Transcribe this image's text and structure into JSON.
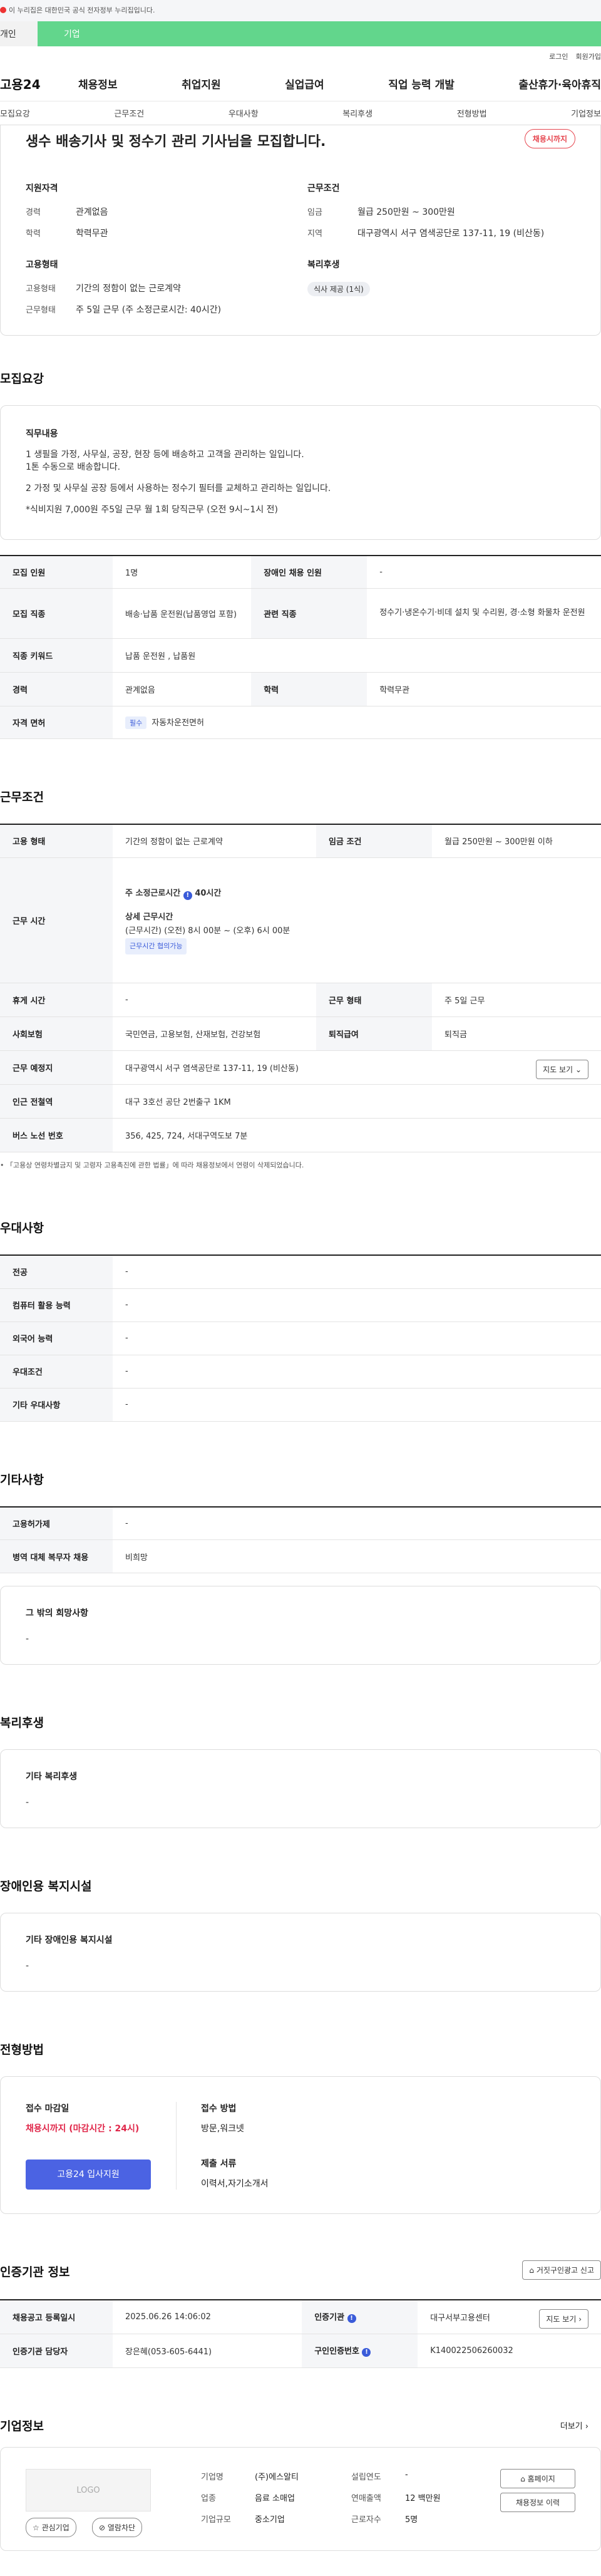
{
  "gov_banner": "이 누리집은 대한민국 공식 전자정부 누리집입니다.",
  "tabs": {
    "personal": "개인",
    "company": "기업"
  },
  "util_links": [
    "로그인",
    "회원가입"
  ],
  "logo": "고용24",
  "gnb": [
    "채용정보",
    "취업지원",
    "실업급여",
    "직업 능력 개발",
    "출산휴가·육아휴직"
  ],
  "anchor_tabs": [
    "모집요강",
    "근무조건",
    "우대사항",
    "복리후생",
    "전형방법",
    "기업정보"
  ],
  "header": {
    "title": "생수 배송기사 및 정수기 관리 기사님을 모집합니다.",
    "status": "채용시까지",
    "support": {
      "heading": "지원자격",
      "rows": [
        {
          "k": "경력",
          "v": "관계없음"
        },
        {
          "k": "학력",
          "v": "학력무관"
        }
      ]
    },
    "employment": {
      "heading": "고용형태",
      "rows": [
        {
          "k": "고용형태",
          "v": "기간의 정함이 없는 근로계약"
        },
        {
          "k": "근무형태",
          "v": "주 5일 근무 (주 소정근로시간: 40시간)"
        }
      ]
    },
    "conditions": {
      "heading": "근무조건",
      "rows": [
        {
          "k": "임금",
          "v": "월급 250만원 ~ 300만원"
        },
        {
          "k": "지역",
          "v": "대구광역시 서구 염색공단로 137-11, 19 (비산동)"
        }
      ]
    },
    "welfare": {
      "heading": "복리후생",
      "chip": "식사 제공 (1식)"
    }
  },
  "recruit": {
    "title": "모집요강",
    "duty_heading": "직무내용",
    "duty_lines": [
      "1 생필을 가정, 사무실, 공장, 현장 등에 배송하고 고객을 관리하는 일입니다.",
      "1톤 수동으로 배송합니다.",
      "",
      "2 가정 및 사무실 공장 등에서 사용하는 정수기 필터를 교체하고 관리하는 일입니다.",
      "",
      "*식비지원 7,000원    주5일 근무    월 1회 당직근무  (오전 9시~1시 전)"
    ],
    "rows": {
      "headcount_k": "모집 인원",
      "headcount_v": "1명",
      "disabled_k": "장애인 채용 인원",
      "disabled_v": "-",
      "job_k": "모집 직종",
      "job_v": "배송·납품 운전원(납품영업 포함)",
      "related_k": "관련 직종",
      "related_v": "정수기·냉온수기·비데 설치 및 수리원, 경·소형 화물차 운전원",
      "keyword_k": "직종 키워드",
      "keyword_v": "납품 운전원 , 납품원",
      "career_k": "경력",
      "career_v": "관계없음",
      "edu_k": "학력",
      "edu_v": "학력무관",
      "license_k": "자격 면허",
      "license_tag": "필수",
      "license_v": "자동차운전면허"
    }
  },
  "work": {
    "title": "근무조건",
    "type_k": "고용 형태",
    "type_v": "기간의 정함이 없는 근로계약",
    "wage_k": "임금 조건",
    "wage_v": "월급 250만원 ~ 300만원 이하",
    "hours_k": "근무 시간",
    "hours_main": "주 소정근로시간",
    "hours_main_value": "40시간",
    "hours_detail_heading": "상세 근무시간",
    "hours_detail": "(근무시간) (오전) 8시 00분 ~ (오후) 6시 00분",
    "hours_tag": "근무시간 협의가능",
    "rest_k": "휴게 시간",
    "rest_v": "-",
    "form_k": "근무 형태",
    "form_v": "주 5일 근무",
    "ins_k": "사회보험",
    "ins_v": "국민연금, 고용보험, 산재보험, 건강보험",
    "pension_k": "퇴직급여",
    "pension_v": "퇴직금",
    "place_k": "근무 예정지",
    "place_v": "대구광역시 서구 염색공단로 137-11, 19 (비산동)",
    "map_btn": "지도 보기",
    "station_k": "인근 전철역",
    "station_v": "대구 3호선 공단 2번출구 1KM",
    "bus_k": "버스 노선 번호",
    "bus_v": "356, 425, 724, 서대구역도보 7분",
    "footnote": "「고용상 연령차별금지 및 고령자 고용촉진에 관한 법률」에 따라 채용정보에서 연령이 삭제되었습니다."
  },
  "pref": {
    "title": "우대사항",
    "rows": [
      {
        "k": "전공",
        "v": "-"
      },
      {
        "k": "컴퓨터 활용 능력",
        "v": "-"
      },
      {
        "k": "외국어 능력",
        "v": "-"
      },
      {
        "k": "우대조건",
        "v": "-"
      },
      {
        "k": "기타 우대사항",
        "v": "-"
      }
    ]
  },
  "etc": {
    "title": "기타사항",
    "rows": [
      {
        "k": "고용허가제",
        "v": "-"
      },
      {
        "k": "병역 대체 복무자 채용",
        "v": "비희망"
      }
    ],
    "other_heading": "그 밖의 희망사항",
    "other_value": "-"
  },
  "welfare": {
    "title": "복리후생",
    "heading": "기타 복리후생",
    "value": "-"
  },
  "disabled": {
    "title": "장애인용 복지시설",
    "heading": "기타 장애인용 복지시설",
    "value": "-"
  },
  "selection": {
    "title": "전형방법",
    "deadline_heading": "접수 마감일",
    "deadline_value": "채용시까지 (마감시간 : 24시)",
    "apply_btn": "고용24 입사지원",
    "method_heading": "접수 방법",
    "method_value": "방문,워크넷",
    "docs_heading": "제출 서류",
    "docs_value": "이력서,자기소개서"
  },
  "agency": {
    "title": "인증기관 정보",
    "report_btn": "거짓구인광고 신고",
    "reg_k": "채용공고 등록일시",
    "reg_v": "2025.06.26 14:06:02",
    "org_k": "인증기관",
    "org_v": "대구서부고용센터",
    "map_btn": "지도 보기",
    "mgr_k": "인증기관 담당자",
    "mgr_v": "장은혜(053-605-6441)",
    "num_k": "구인인증번호",
    "num_v": "K140022506260032"
  },
  "company": {
    "title": "기업정보",
    "more": "더보기",
    "logo_text": "LOGO",
    "interest_btn": "관심기업",
    "block_btn": "열람차단",
    "name_k": "기업명",
    "name_v": "(주)에스알티",
    "founded_k": "설립연도",
    "founded_v": "-",
    "industry_k": "업종",
    "industry_v": "음료 소매업",
    "sales_k": "연매출액",
    "sales_v": "12 백만원",
    "size_k": "기업규모",
    "size_v": "중소기업",
    "emp_k": "근로자수",
    "emp_v": "5명",
    "home_btn": "홈페이지",
    "history_btn": "채용정보 이력"
  }
}
